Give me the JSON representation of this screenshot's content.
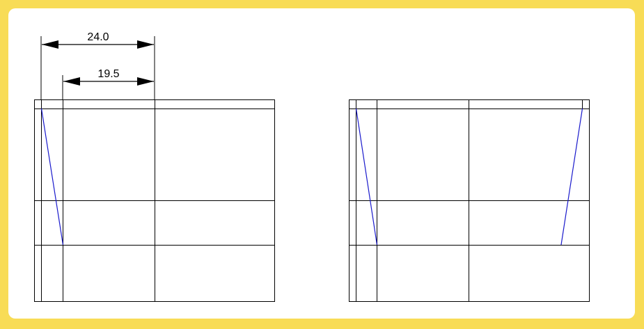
{
  "colors": {
    "background": "#f8dc56",
    "panel": "#ffffff",
    "grid_line": "#000000",
    "accent_line": "#1a1acc"
  },
  "dimensions": {
    "outer_label": "24.0",
    "inner_label": "19.5"
  }
}
